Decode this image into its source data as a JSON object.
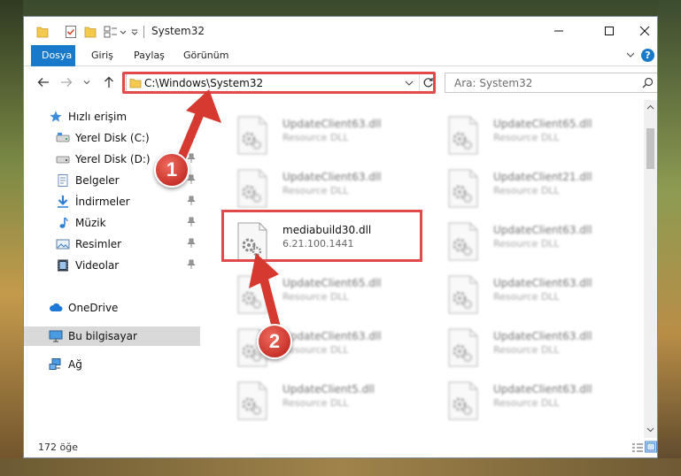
{
  "window": {
    "title": "System32"
  },
  "ribbon": {
    "tabs": [
      "Dosya",
      "Giriş",
      "Paylaş",
      "Görünüm"
    ]
  },
  "address": {
    "path": "C:\\Windows\\System32",
    "search_placeholder": "Ara: System32"
  },
  "nav": {
    "items": [
      {
        "label": "Hızlı erişim",
        "icon": "star-icon",
        "pinned": false
      },
      {
        "label": "Yerel Disk (C:)",
        "icon": "drive-icon",
        "pinned": true
      },
      {
        "label": "Yerel Disk (D:)",
        "icon": "drive-icon",
        "pinned": true
      },
      {
        "label": "Belgeler",
        "icon": "documents-icon",
        "pinned": true
      },
      {
        "label": "İndirmeler",
        "icon": "downloads-icon",
        "pinned": true
      },
      {
        "label": "Müzik",
        "icon": "music-icon",
        "pinned": true
      },
      {
        "label": "Resimler",
        "icon": "pictures-icon",
        "pinned": true
      },
      {
        "label": "Videolar",
        "icon": "videos-icon",
        "pinned": true
      },
      {
        "label": "OneDrive",
        "icon": "cloud-icon",
        "pinned": false
      },
      {
        "label": "Bu bilgisayar",
        "icon": "computer-icon",
        "pinned": false,
        "selected": true
      },
      {
        "label": "Ağ",
        "icon": "network-icon",
        "pinned": false
      }
    ]
  },
  "files": {
    "left": [
      {
        "name": "UpdateClient63.dll",
        "desc": "Resource DLL"
      },
      {
        "name": "UpdateClient63.dll",
        "desc": "Resource DLL"
      },
      {
        "name": "mediabuild30.dll",
        "desc": "6.21.100.1441"
      },
      {
        "name": "UpdateClient65.dll",
        "desc": "Resource DLL"
      },
      {
        "name": "UpdateClient63.dll",
        "desc": "Resource DLL"
      },
      {
        "name": "UpdateClient5.dll",
        "desc": "Resource DLL"
      }
    ],
    "right": [
      {
        "name": "UpdateClient65.dll",
        "desc": "Resource DLL"
      },
      {
        "name": "UpdateClient21.dll",
        "desc": "Resource DLL"
      },
      {
        "name": "UpdateClient63.dll",
        "desc": "Resource DLL"
      },
      {
        "name": "UpdateClient63.dll",
        "desc": "Resource DLL"
      },
      {
        "name": "UpdateClient63.dll",
        "desc": "Resource DLL"
      },
      {
        "name": "UpdateClient63.dll",
        "desc": "Resource DLL"
      }
    ]
  },
  "status": {
    "count": "172 öğe"
  },
  "annotations": {
    "step1": "1",
    "step2": "2",
    "color": "#d6392f"
  }
}
